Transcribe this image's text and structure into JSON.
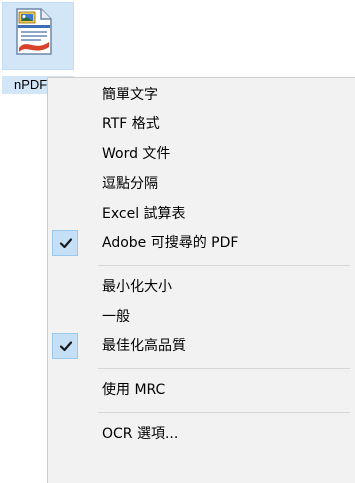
{
  "file": {
    "name": "nPDF",
    "icon": "pdf-document-icon"
  },
  "menu": {
    "items": [
      {
        "label": "簡單文字",
        "checked": false
      },
      {
        "label": "RTF 格式",
        "checked": false
      },
      {
        "label": "Word 文件",
        "checked": false
      },
      {
        "label": "逗點分隔",
        "checked": false
      },
      {
        "label": "Excel 試算表",
        "checked": false
      },
      {
        "label": "Adobe 可搜尋的 PDF",
        "checked": true
      },
      {
        "label": "最小化大小",
        "checked": false
      },
      {
        "label": "一般",
        "checked": false
      },
      {
        "label": "最佳化高品質",
        "checked": true
      },
      {
        "label": "使用 MRC",
        "checked": false
      },
      {
        "label": "OCR 選項...",
        "checked": false
      }
    ]
  },
  "colors": {
    "menu_background": "#f2f2f2",
    "check_highlight": "#c5dff6",
    "check_border": "#99c9ef",
    "selection_tile": "#d3e6f8",
    "check_mark": "#1a1a1a"
  }
}
